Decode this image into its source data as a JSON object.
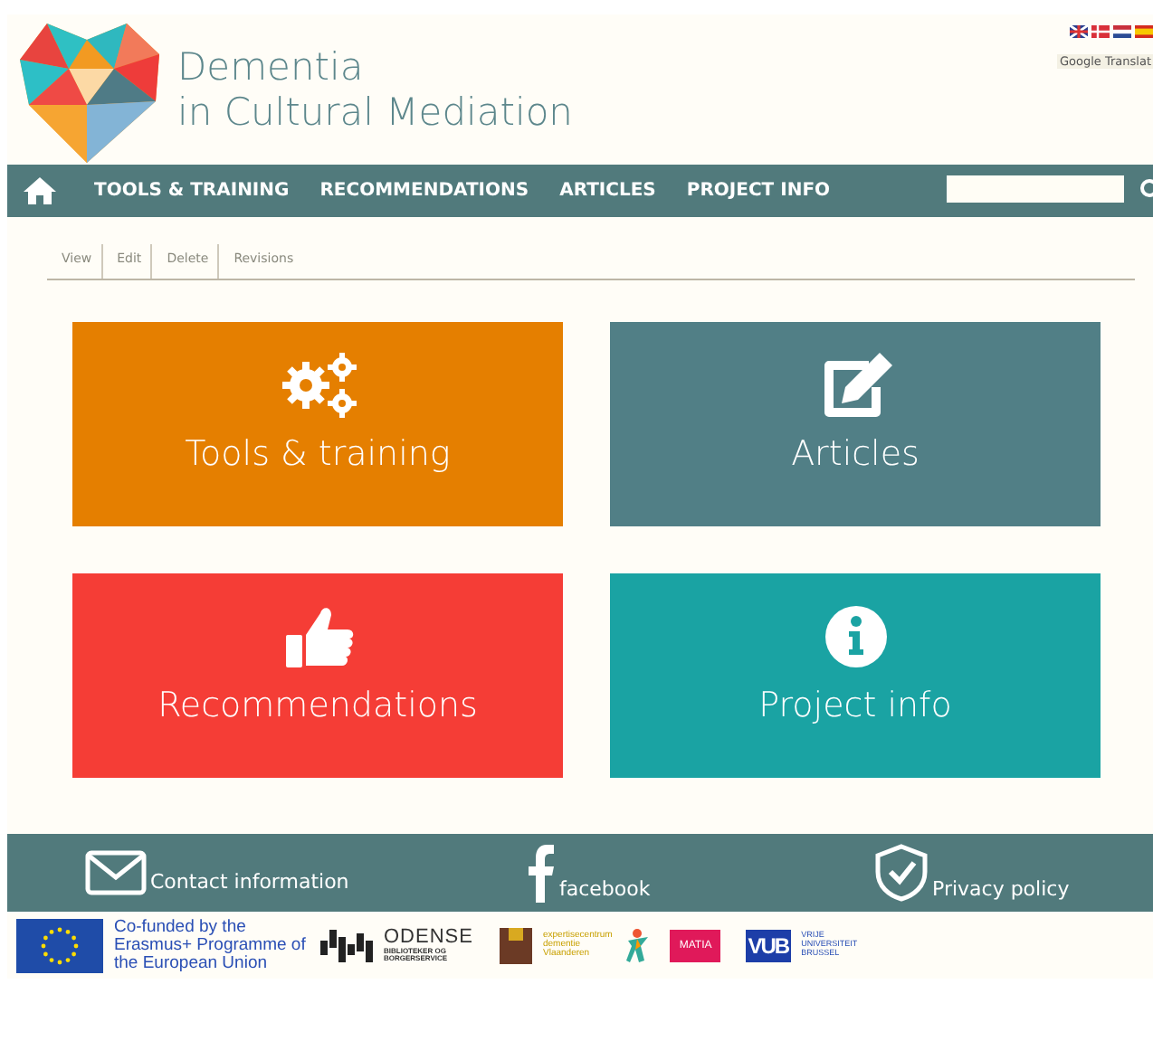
{
  "header": {
    "title_line_1": "Dementia",
    "title_line_2": "in Cultural Mediation",
    "translate_label": "Google Translat"
  },
  "nav": {
    "items": [
      {
        "label": "TOOLS & TRAINING"
      },
      {
        "label": "RECOMMENDATIONS"
      },
      {
        "label": "ARTICLES"
      },
      {
        "label": "PROJECT INFO"
      }
    ]
  },
  "local_tabs": [
    {
      "label": "View"
    },
    {
      "label": "Edit"
    },
    {
      "label": "Delete"
    },
    {
      "label": "Revisions"
    }
  ],
  "tiles": [
    {
      "label": "Tools & training",
      "kind": "gears",
      "color": "#e57f00"
    },
    {
      "label": "Articles",
      "kind": "edit",
      "color": "#517f86"
    },
    {
      "label": "Recommendations",
      "kind": "thumbs-up",
      "color": "#f53d36"
    },
    {
      "label": "Project info",
      "kind": "info",
      "color": "#1aa3a3"
    }
  ],
  "footer": {
    "links": [
      {
        "label": "Contact information",
        "kind": "envelope"
      },
      {
        "label": "facebook",
        "kind": "facebook"
      },
      {
        "label": "Privacy policy",
        "kind": "shield"
      }
    ]
  },
  "partners": {
    "erasmus": "Co-funded by the Erasmus+ Programme of the European Union",
    "odense_name": "ODENSE",
    "odense_sub": "BIBLIOTEKER OG BORGERSERVICE",
    "expertise_line_1": "expertisecentrum",
    "expertise_line_2": "dementie",
    "expertise_line_3": "Vlaanderen",
    "matia": "MATIA",
    "vub": "VUB",
    "vub_sub": "VRIJE UNIVERSITEIT BRUSSEL"
  }
}
